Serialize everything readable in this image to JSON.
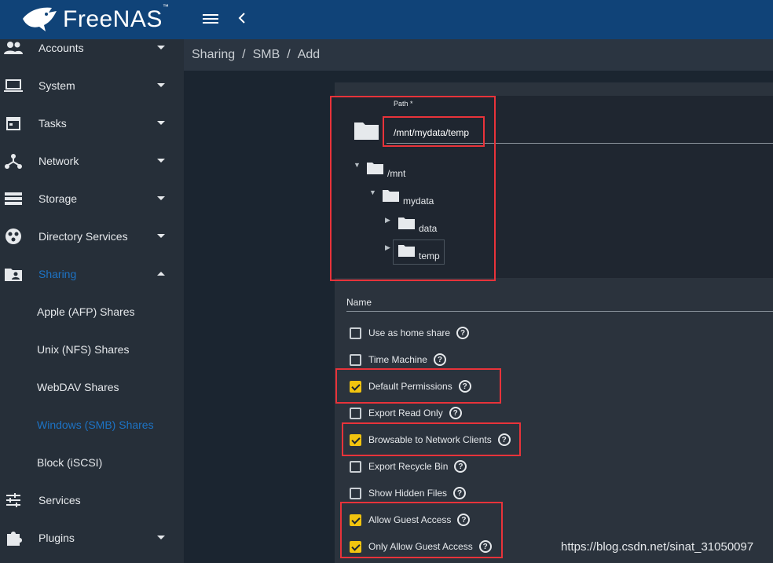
{
  "app": {
    "title": "FreeNAS"
  },
  "sidebar": {
    "items": [
      {
        "label": "Accounts",
        "icon": "people-icon",
        "has_caret": true
      },
      {
        "label": "System",
        "icon": "laptop-icon",
        "has_caret": true
      },
      {
        "label": "Tasks",
        "icon": "calendar-icon",
        "has_caret": true
      },
      {
        "label": "Network",
        "icon": "network-icon",
        "has_caret": true
      },
      {
        "label": "Storage",
        "icon": "storage-icon",
        "has_caret": true
      },
      {
        "label": "Directory Services",
        "icon": "directory-icon",
        "has_caret": true
      },
      {
        "label": "Sharing",
        "icon": "folder-shared-icon",
        "has_caret": true,
        "expanded": true,
        "active": true
      }
    ],
    "sharing_subitems": [
      {
        "label": "Apple (AFP) Shares"
      },
      {
        "label": "Unix (NFS) Shares"
      },
      {
        "label": "WebDAV Shares"
      },
      {
        "label": "Windows (SMB) Shares",
        "active": true
      },
      {
        "label": "Block (iSCSI)"
      }
    ],
    "bottom_items": [
      {
        "label": "Services",
        "icon": "tune-icon",
        "has_caret": false
      },
      {
        "label": "Plugins",
        "icon": "puzzle-icon",
        "has_caret": true
      }
    ]
  },
  "breadcrumb": {
    "items": [
      "Sharing",
      "SMB",
      "Add"
    ],
    "separator": "/"
  },
  "path_field": {
    "label": "Path *",
    "value": "/mnt/mydata/temp",
    "tree": [
      {
        "label": "/mnt"
      },
      {
        "label": "mydata"
      },
      {
        "label": "data"
      },
      {
        "label": "temp"
      }
    ]
  },
  "name_field": {
    "label": "Name"
  },
  "options": [
    {
      "label": "Use as home share",
      "checked": false
    },
    {
      "label": "Time Machine",
      "checked": false
    },
    {
      "label": "Default Permissions",
      "checked": true
    },
    {
      "label": "Export Read Only",
      "checked": false
    },
    {
      "label": "Browsable to Network Clients",
      "checked": true
    },
    {
      "label": "Export Recycle Bin",
      "checked": false
    },
    {
      "label": "Show Hidden Files",
      "checked": false
    },
    {
      "label": "Allow Guest Access",
      "checked": true
    },
    {
      "label": "Only Allow Guest Access",
      "checked": true
    }
  ],
  "help_glyph": "?",
  "watermark": "https://blog.csdn.net/sinat_31050097",
  "colors": {
    "topbar": "#104378",
    "sidebar": "#262f39",
    "accent": "#1d73c4",
    "checkbox_checked": "#f1c40f",
    "annotation": "#e8333a"
  }
}
